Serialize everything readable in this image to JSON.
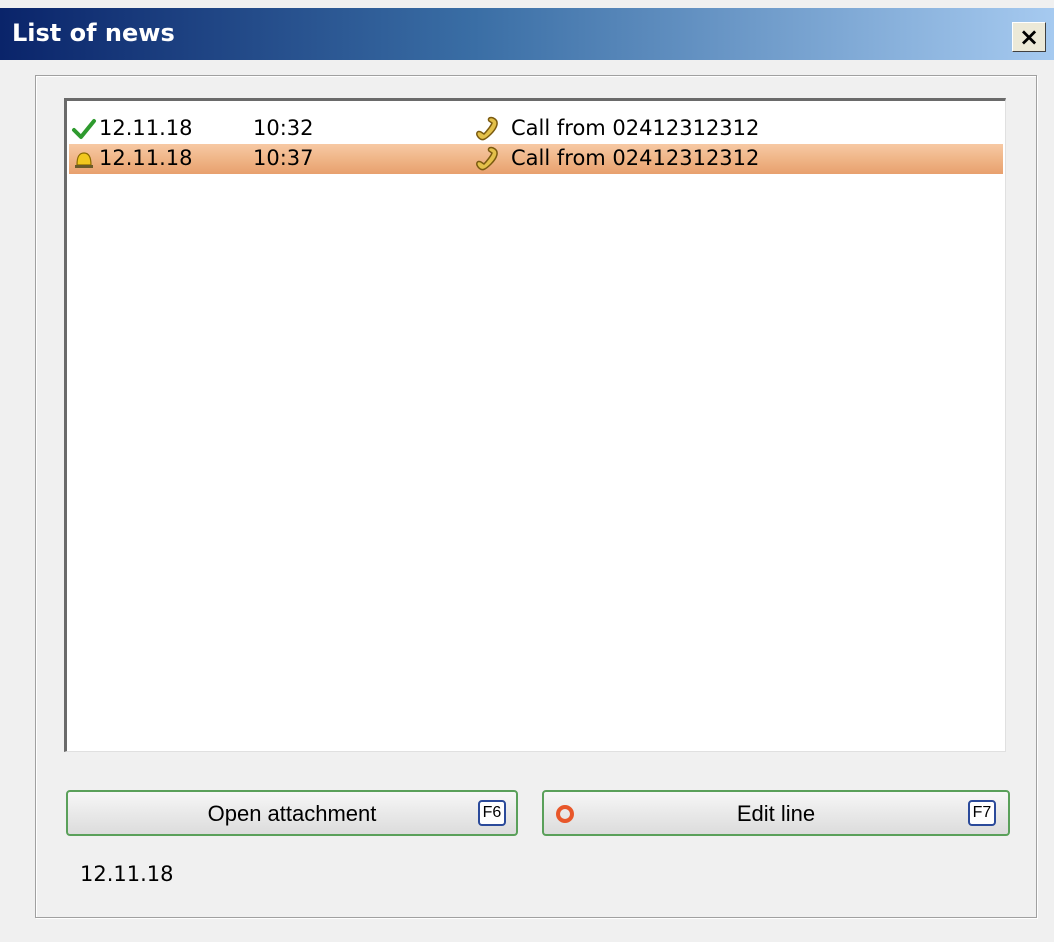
{
  "window": {
    "title": "List of news",
    "close_glyph": "×"
  },
  "news": {
    "rows": [
      {
        "status_icon": "check-icon",
        "date": "12.11.18",
        "time": "10:32",
        "type_icon": "phone-icon",
        "text": "Call from 02412312312",
        "selected": false
      },
      {
        "status_icon": "bell-icon",
        "date": "12.11.18",
        "time": "10:37",
        "type_icon": "phone-icon",
        "text": "Call from 02412312312",
        "selected": true
      }
    ]
  },
  "buttons": {
    "open_attachment": {
      "label": "Open attachment",
      "key": "F6"
    },
    "edit_line": {
      "label": "Edit line",
      "key": "F7"
    }
  },
  "status": {
    "date": "12.11.18"
  },
  "colors": {
    "titlebar_start": "#0a246a",
    "titlebar_end": "#a6caf0",
    "selected_row": "#eeb182",
    "button_border": "#5aa05a",
    "key_border": "#2b4a9a",
    "edit_icon": "#e8572a",
    "check": "#2e9a2e"
  }
}
